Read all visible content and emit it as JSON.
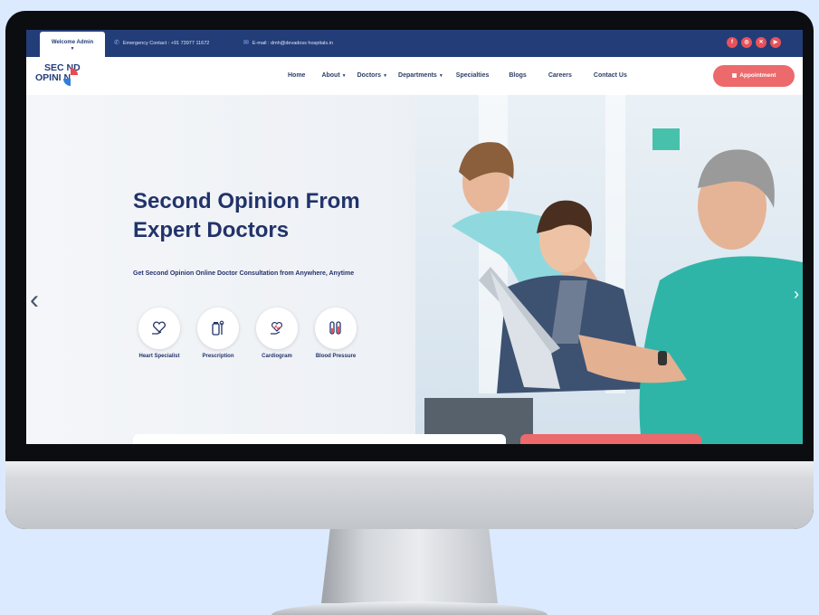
{
  "topbar": {
    "welcome_label": "Welcome Admin",
    "emergency": "Emergency Contact : +91 73977 11672",
    "email": "E-mail : dmh@devadoss hospitals.in",
    "socials": [
      "facebook-icon",
      "instagram-icon",
      "twitter-icon",
      "youtube-icon"
    ],
    "social_glyphs": [
      "f",
      "◎",
      "✕",
      "▶"
    ]
  },
  "logo": {
    "line1": "SEC ND",
    "line2": "OPINI N"
  },
  "nav": {
    "items": [
      {
        "label": "Home",
        "caret": ""
      },
      {
        "label": "About",
        "caret": "▼"
      },
      {
        "label": "Doctors",
        "caret": "▼"
      },
      {
        "label": "Departments",
        "caret": "▼"
      },
      {
        "label": "Specialties",
        "caret": ""
      },
      {
        "label": "Blogs",
        "caret": ""
      },
      {
        "label": "Careers",
        "caret": ""
      },
      {
        "label": "Contact Us",
        "caret": ""
      }
    ],
    "appointment_label": "Appointment"
  },
  "hero": {
    "title_line1": "Second Opinion From",
    "title_line2": "Expert Doctors",
    "subtitle": "Get Second Opinion Online Doctor Consultation from Anywhere, Anytime",
    "features": [
      {
        "label": "Heart Specialist",
        "icon": "heart-hand-icon"
      },
      {
        "label": "Prescription",
        "icon": "prescription-icon"
      },
      {
        "label": "Cardiogram",
        "icon": "cardiogram-icon"
      },
      {
        "label": "Blood Pressure",
        "icon": "blood-pressure-icon"
      }
    ]
  },
  "colors": {
    "navy": "#233d78",
    "accent": "#ec6a6c",
    "text": "#22336a"
  }
}
